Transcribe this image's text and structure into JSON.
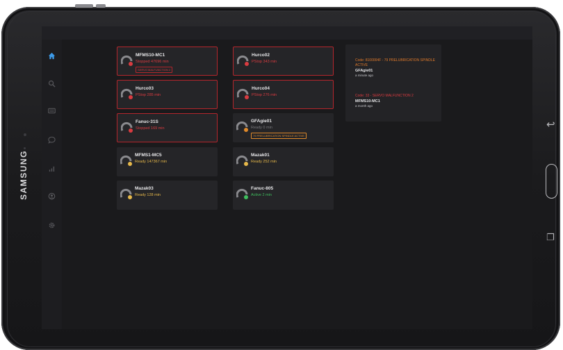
{
  "device": {
    "brand": "SAMSUNG"
  },
  "sidebar": {
    "items": [
      {
        "name": "home",
        "icon": "home-icon",
        "color": "#3d9be9",
        "active": true
      },
      {
        "name": "search",
        "icon": "search-icon",
        "color": "#56565a"
      },
      {
        "name": "machines",
        "icon": "keyboard-icon",
        "color": "#56565a"
      },
      {
        "name": "messages",
        "icon": "chat-icon",
        "color": "#56565a"
      },
      {
        "name": "analytics",
        "icon": "bar-chart-icon",
        "color": "#56565a"
      },
      {
        "name": "account",
        "icon": "user-icon",
        "color": "#56565a"
      },
      {
        "name": "settings",
        "icon": "gear-icon",
        "color": "#56565a"
      }
    ]
  },
  "machines": [
    {
      "name": "MFMS10-MC1",
      "status": "Stopped 47696 min",
      "state": "stopped",
      "alarm": true,
      "tag": "SERVO MALFUNCTION 2"
    },
    {
      "name": "Hurco02",
      "status": "PStop 343 min",
      "state": "pstop",
      "alarm": true
    },
    {
      "name": "Hurco03",
      "status": "PStop 285 min",
      "state": "pstop",
      "alarm": true
    },
    {
      "name": "Hurco04",
      "status": "PStop 276 min",
      "state": "pstop",
      "alarm": true
    },
    {
      "name": "Fanuc-31S",
      "status": "Stopped 169 min",
      "state": "stopped",
      "alarm": true
    },
    {
      "name": "GFAgie01",
      "status": "Ready 0 min",
      "state": "ready-dim",
      "alarm": false,
      "tag": "79 PRELUBRICATION SPINDLE ACTIVE"
    },
    {
      "name": "MFMS1-MC5",
      "status": "Ready 147367 min",
      "state": "ready",
      "alarm": false
    },
    {
      "name": "Mazak01",
      "status": "Ready 252 min",
      "state": "ready",
      "alarm": false
    },
    {
      "name": "Mazak03",
      "status": "Ready 128 min",
      "state": "ready",
      "alarm": false
    },
    {
      "name": "Fanuc-805",
      "status": "Active 2 min",
      "state": "active",
      "alarm": false
    }
  ],
  "alerts": [
    {
      "code": "Code: 8100004F - 79 PRELUBRICATION SPINDLE ACTIVE",
      "machine": "GFAgie01",
      "time": "a minute ago",
      "color": "#e07a2b"
    },
    {
      "code": "Code: 33 - SERVO MALFUNCTION 2",
      "machine": "MFMS10-MC1",
      "time": "a month ago",
      "color": "#d93b40"
    }
  ],
  "colors": {
    "alarm_border": "#b5262c",
    "stopped": "#d93b40",
    "ready": "#e6b84a",
    "active": "#3fbf5e",
    "accent": "#3d9be9"
  }
}
